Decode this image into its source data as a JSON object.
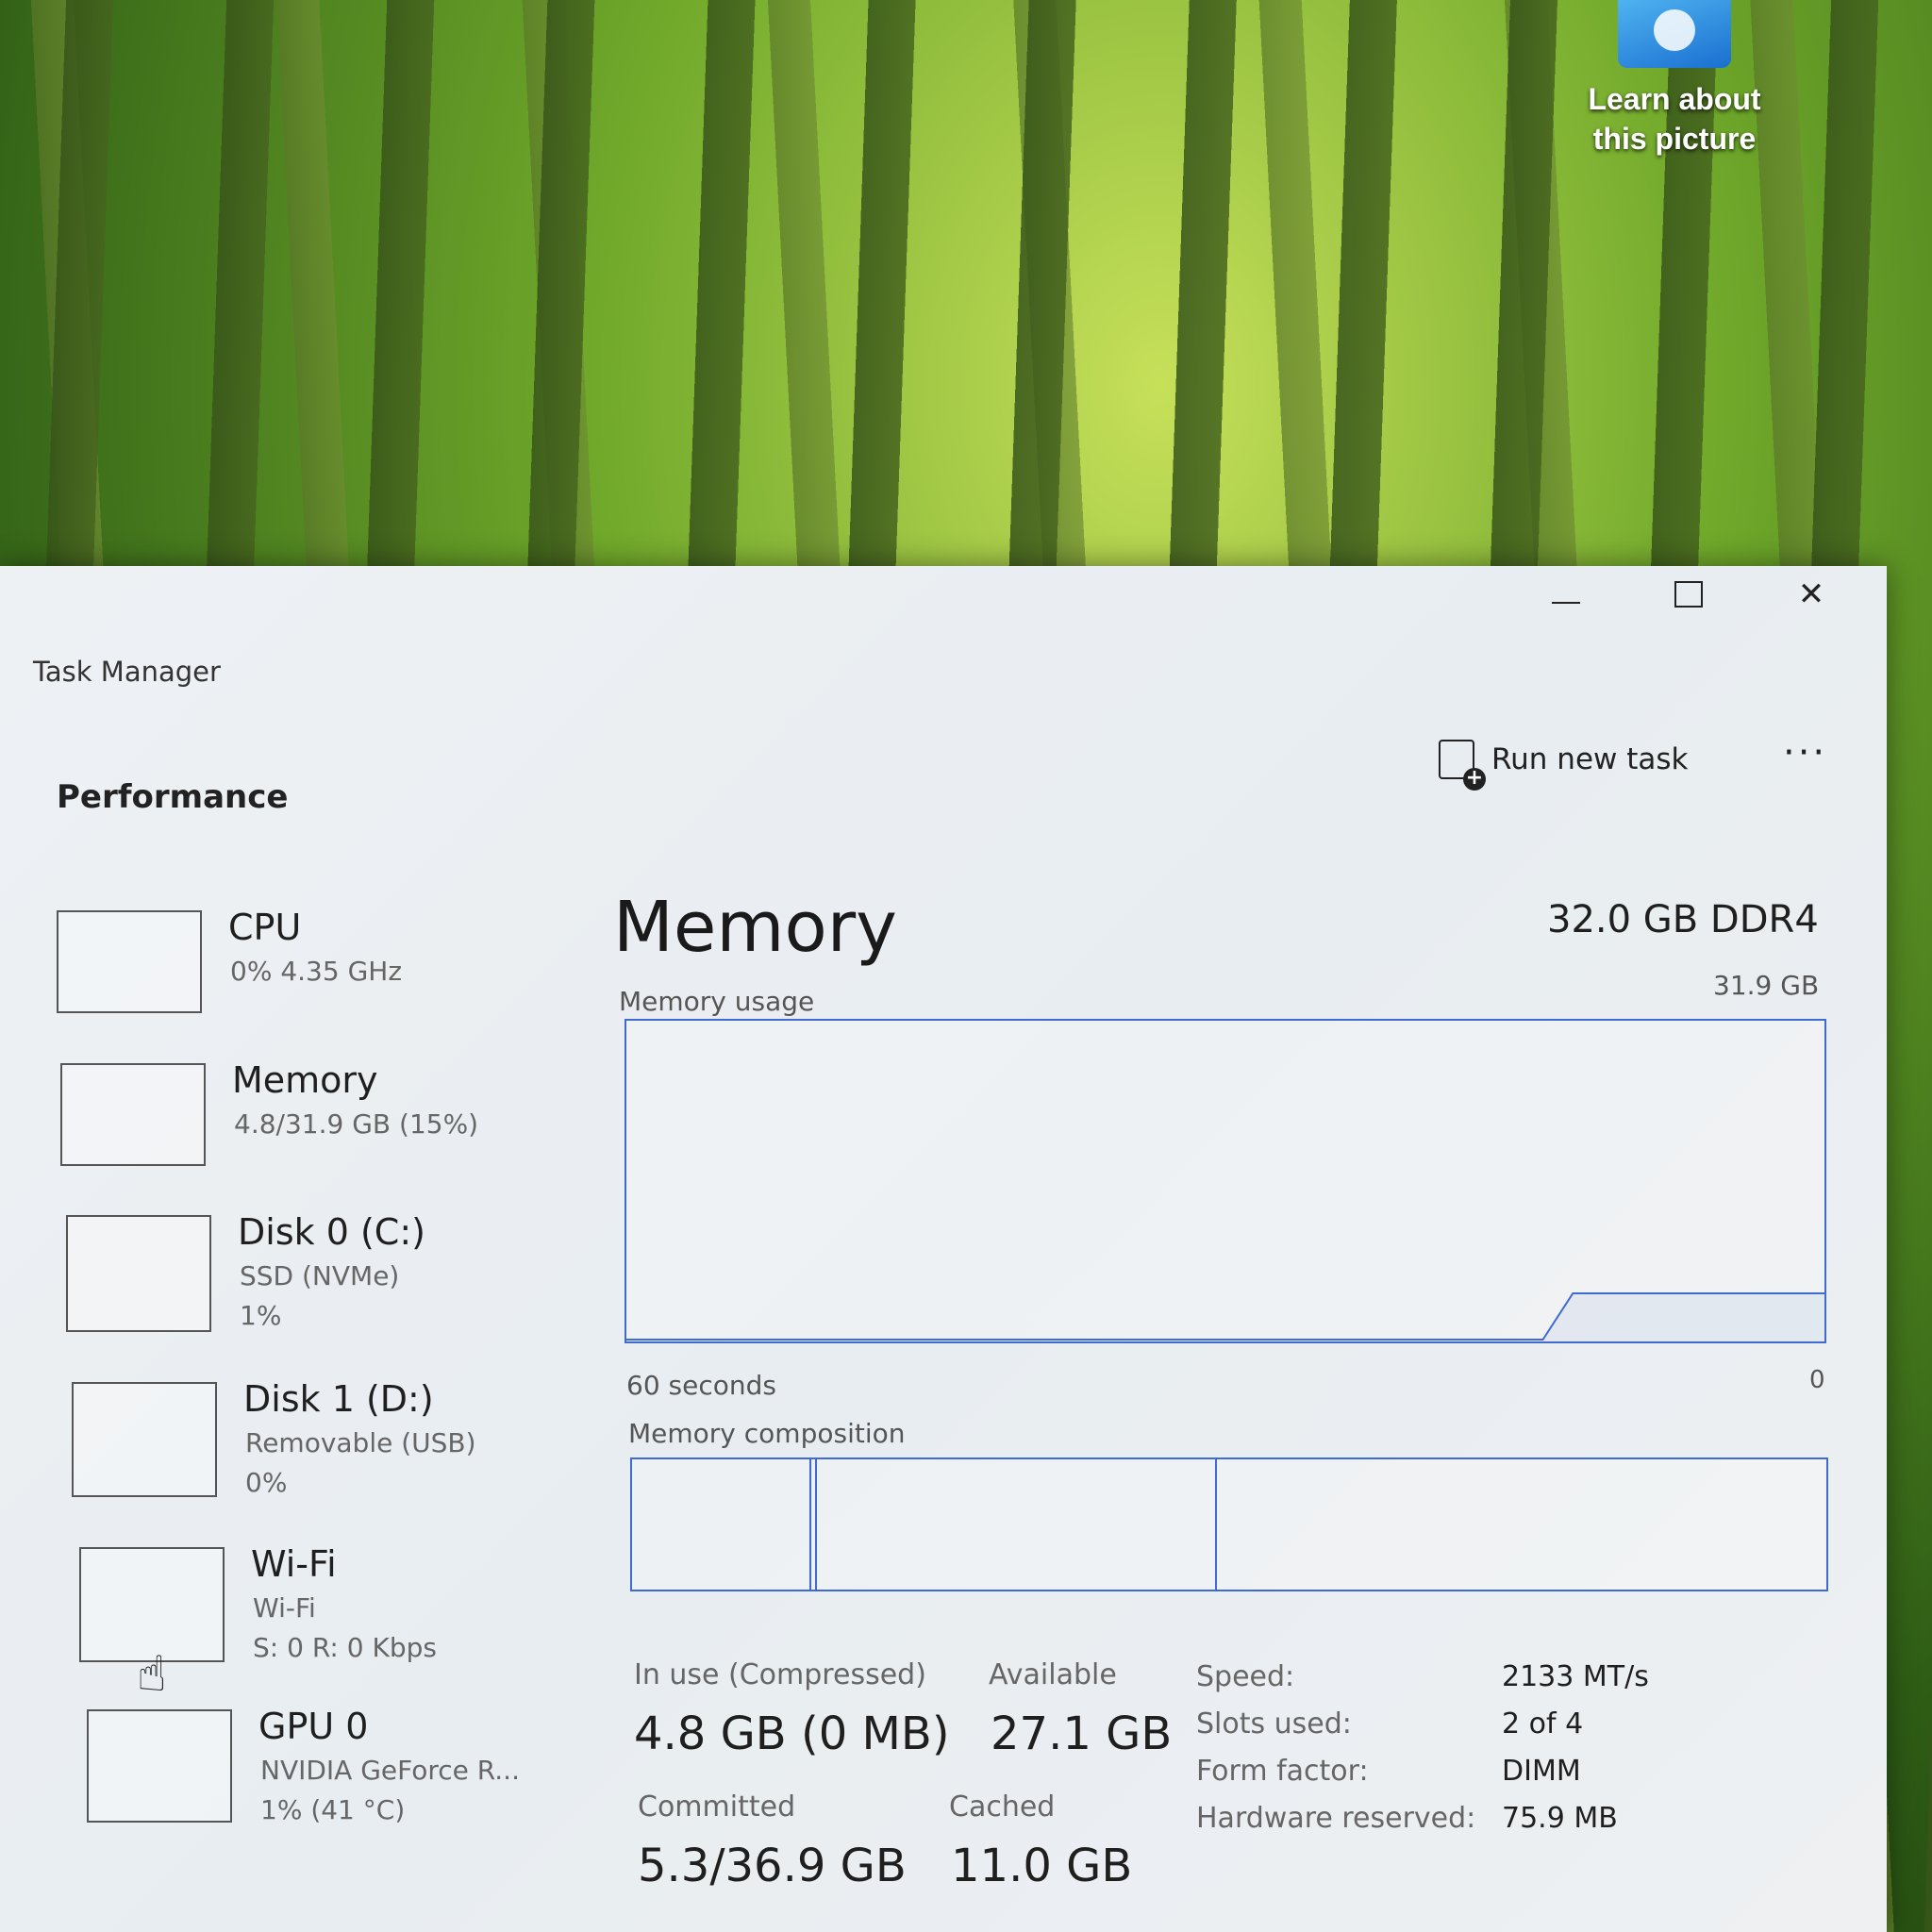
{
  "desktop": {
    "learn_about": "Learn about\nthis picture"
  },
  "window": {
    "title": "Task Manager",
    "controls": {
      "minimize": "minimize-icon",
      "maximize": "maximize-icon",
      "close": "✕"
    }
  },
  "toolbar": {
    "section_title": "Performance",
    "run_new_task": "Run new task",
    "more": "···"
  },
  "sidebar": {
    "items": [
      {
        "title": "CPU",
        "subtitle": "0% 4.35 GHz"
      },
      {
        "title": "Memory",
        "subtitle": "4.8/31.9 GB (15%)"
      },
      {
        "title": "Disk 0 (C:)",
        "subtitle": "SSD (NVMe)\n1%"
      },
      {
        "title": "Disk 1 (D:)",
        "subtitle": "Removable (USB)\n0%"
      },
      {
        "title": "Wi-Fi",
        "subtitle": "Wi-Fi\nS: 0 R: 0 Kbps"
      },
      {
        "title": "GPU 0",
        "subtitle": "NVIDIA GeForce R...\n1% (41 °C)"
      }
    ]
  },
  "main": {
    "title": "Memory",
    "total": "32.0 GB DDR4",
    "usage_label": "Memory usage",
    "usage_max": "31.9 GB",
    "axis_left": "60 seconds",
    "axis_right": "0",
    "composition_label": "Memory composition",
    "composition_fractions": [
      0.15,
      0.005,
      0.335,
      0.51
    ],
    "usage_history_fraction": {
      "start": 0.0,
      "recent": 0.15
    },
    "stats": {
      "in_use_label": "In use (Compressed)",
      "in_use_value": "4.8 GB (0 MB)",
      "available_label": "Available",
      "available_value": "27.1 GB",
      "committed_label": "Committed",
      "committed_value": "5.3/36.9 GB",
      "cached_label": "Cached",
      "cached_value": "11.0 GB"
    },
    "details": [
      {
        "label": "Speed:",
        "value": "2133 MT/s"
      },
      {
        "label": "Slots used:",
        "value": "2 of 4"
      },
      {
        "label": "Form factor:",
        "value": "DIMM"
      },
      {
        "label": "Hardware reserved:",
        "value": "75.9 MB"
      }
    ]
  },
  "colors": {
    "accent": "#3f6ad1",
    "window_bg": "#eef1f4"
  }
}
